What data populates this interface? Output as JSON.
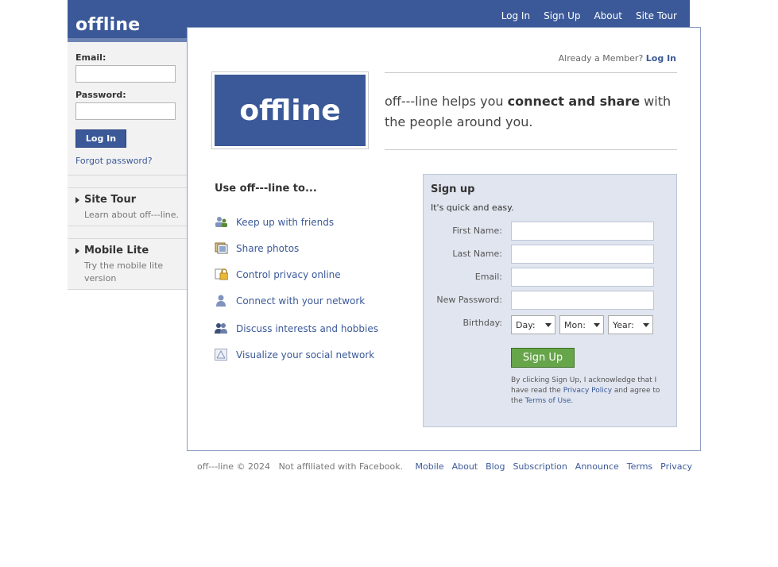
{
  "header": {
    "logo": "offline",
    "nav": [
      "Log In",
      "Sign Up",
      "About",
      "Site Tour"
    ]
  },
  "login": {
    "email_label": "Email:",
    "password_label": "Password:",
    "button": "Log In",
    "forgot": "Forgot password?"
  },
  "sidebar": {
    "site_tour_title": "Site Tour",
    "site_tour_desc": "Learn about off---line.",
    "mobile_title": "Mobile Lite",
    "mobile_desc": "Try the mobile lite version"
  },
  "main": {
    "already_member": "Already a Member?",
    "login_link": "Log In",
    "big_logo": "offline",
    "tagline_pre": "off---line helps you ",
    "tagline_bold": "connect and share",
    "tagline_post": " with the people around you.",
    "use_title": "Use off---line to...",
    "features": [
      {
        "icon": "friends-icon",
        "label": "Keep up with friends"
      },
      {
        "icon": "photos-icon",
        "label": "Share photos"
      },
      {
        "icon": "lock-icon",
        "label": "Control privacy online"
      },
      {
        "icon": "person-icon",
        "label": "Connect with your network"
      },
      {
        "icon": "group-icon",
        "label": "Discuss interests and hobbies"
      },
      {
        "icon": "network-icon",
        "label": "Visualize your social network"
      }
    ]
  },
  "signup": {
    "title": "Sign up",
    "subtitle": "It's quick and easy.",
    "first_name": "First Name:",
    "last_name": "Last Name:",
    "email": "Email:",
    "new_password": "New Password:",
    "birthday": "Birthday:",
    "day": "Day:",
    "month": "Mon:",
    "year": "Year:",
    "button": "Sign Up",
    "legal_pre": "By clicking Sign Up, I acknowledge that I have read the ",
    "privacy_policy": "Privacy Policy",
    "legal_mid": " and agree to the ",
    "terms": "Terms of Use",
    "legal_post": "."
  },
  "footer": {
    "copyright": "off---line © 2024",
    "disclaimer": "Not affiliated with Facebook.",
    "links": [
      "Mobile",
      "About",
      "Blog",
      "Subscription",
      "Announce",
      "Terms",
      "Privacy"
    ]
  },
  "colors": {
    "brand": "#3b5998",
    "signup_bg": "#e0e5ef",
    "signup_button": "#67a54b"
  }
}
